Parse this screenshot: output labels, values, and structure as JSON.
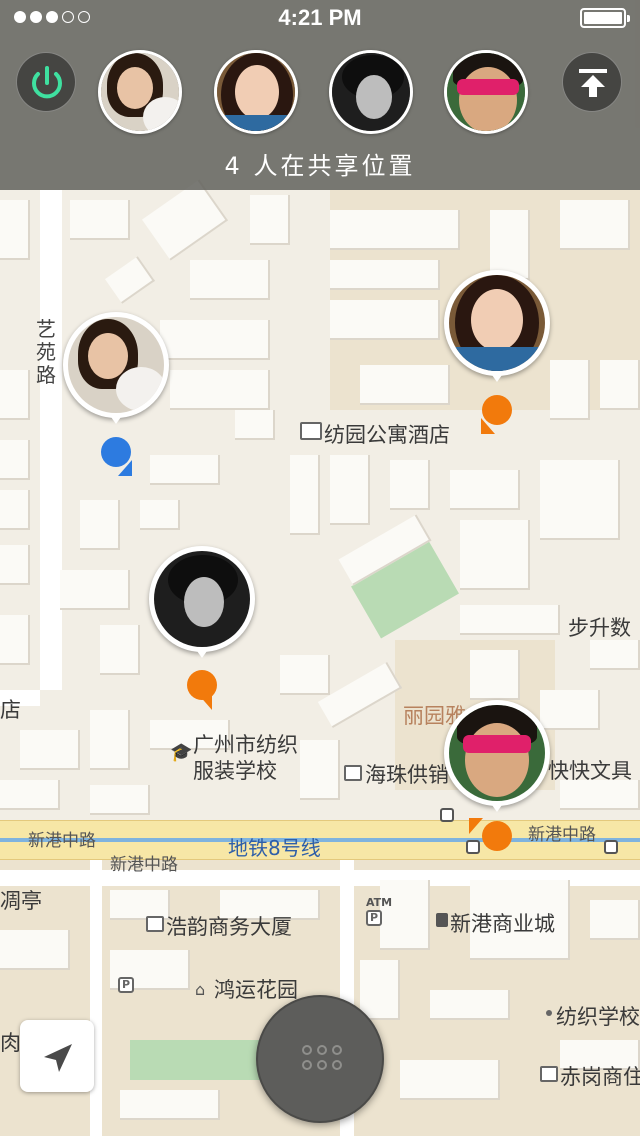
{
  "status_bar": {
    "signal_dots_filled": 3,
    "signal_dots_total": 5,
    "time": "4:21 PM",
    "battery_level": 1.0
  },
  "share_panel": {
    "status_text": "4 人在共享位置",
    "power_icon": "power-icon",
    "upload_icon": "move-to-top-icon",
    "accent_color": "#3fe0a0",
    "avatars": [
      {
        "name": "avatar-girl-with-cat"
      },
      {
        "name": "avatar-girl-braids"
      },
      {
        "name": "avatar-man-bw"
      },
      {
        "name": "avatar-man-sunglasses"
      }
    ]
  },
  "map": {
    "labels": {
      "yiyuan_road": "艺苑路",
      "hotel": "纺园公寓酒店",
      "bu_sheng": "步升数",
      "dian": "店",
      "liyuan": "丽园雅",
      "school_line1": "广州市纺织",
      "school_line2": "服装学校",
      "haizhu": "海珠供销",
      "kuaikuai": "快快文具",
      "xingang_road_1": "新港中路",
      "xingang_road_2": "新港中路",
      "xingang_road_3": "新港中路",
      "metro_line": "地铁8号线",
      "ting": "凋亭",
      "haoyun": "浩韵商务大厦",
      "atm": "ATM",
      "xingang_mall": "新港商业城",
      "hongyun": "鸿运花园",
      "fangzhi_school": "纺织学校",
      "lamian": "肉拉面",
      "chigang": "赤岗商住"
    },
    "colors": {
      "blue_pin": "#2d7be0",
      "orange_pin": "#f27a0c",
      "metro": "#7fb3de"
    }
  },
  "controls": {
    "locate_icon": "location-arrow-icon",
    "menu_icon": "grid-dots-icon"
  }
}
